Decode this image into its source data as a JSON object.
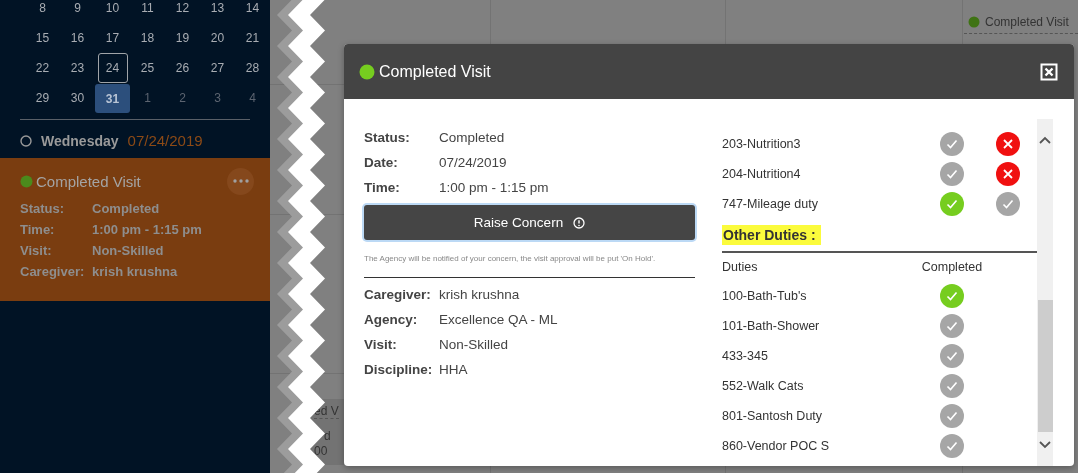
{
  "calendar": {
    "weeks": [
      [
        {
          "day": "8",
          "outside": false,
          "today": false,
          "selected": false
        },
        {
          "day": "9",
          "outside": false,
          "today": false,
          "selected": false
        },
        {
          "day": "10",
          "outside": false,
          "today": false,
          "selected": false
        },
        {
          "day": "11",
          "outside": false,
          "today": false,
          "selected": false
        },
        {
          "day": "12",
          "outside": false,
          "today": false,
          "selected": false
        },
        {
          "day": "13",
          "outside": false,
          "today": false,
          "selected": false
        },
        {
          "day": "14",
          "outside": false,
          "today": false,
          "selected": false
        }
      ],
      [
        {
          "day": "15",
          "outside": false,
          "today": false,
          "selected": false
        },
        {
          "day": "16",
          "outside": false,
          "today": false,
          "selected": false
        },
        {
          "day": "17",
          "outside": false,
          "today": false,
          "selected": false
        },
        {
          "day": "18",
          "outside": false,
          "today": false,
          "selected": false
        },
        {
          "day": "19",
          "outside": false,
          "today": false,
          "selected": false
        },
        {
          "day": "20",
          "outside": false,
          "today": false,
          "selected": false
        },
        {
          "day": "21",
          "outside": false,
          "today": false,
          "selected": false
        }
      ],
      [
        {
          "day": "22",
          "outside": false,
          "today": false,
          "selected": false
        },
        {
          "day": "23",
          "outside": false,
          "today": false,
          "selected": false
        },
        {
          "day": "24",
          "outside": false,
          "today": true,
          "selected": false
        },
        {
          "day": "25",
          "outside": false,
          "today": false,
          "selected": false
        },
        {
          "day": "26",
          "outside": false,
          "today": false,
          "selected": false
        },
        {
          "day": "27",
          "outside": false,
          "today": false,
          "selected": false
        },
        {
          "day": "28",
          "outside": false,
          "today": false,
          "selected": false
        }
      ],
      [
        {
          "day": "29",
          "outside": false,
          "today": false,
          "selected": false
        },
        {
          "day": "30",
          "outside": false,
          "today": false,
          "selected": false
        },
        {
          "day": "31",
          "outside": false,
          "today": false,
          "selected": true
        },
        {
          "day": "1",
          "outside": true,
          "today": false,
          "selected": false
        },
        {
          "day": "2",
          "outside": true,
          "today": false,
          "selected": false
        },
        {
          "day": "3",
          "outside": true,
          "today": false,
          "selected": false
        },
        {
          "day": "4",
          "outside": true,
          "today": false,
          "selected": false
        }
      ]
    ]
  },
  "day_heading": {
    "weekday": "Wednesday",
    "date": "07/24/2019"
  },
  "visit_card": {
    "title": "Completed Visit",
    "fields": [
      {
        "label": "Status:",
        "value": "Completed"
      },
      {
        "label": "Time:",
        "value": "1:00 pm - 1:15 pm"
      },
      {
        "label": "Visit:",
        "value": "Non-Skilled"
      },
      {
        "label": "Caregiver:",
        "value": "krish krushna"
      }
    ]
  },
  "background": {
    "event_title": "Completed Visit",
    "fragments": [
      "ed V",
      "d",
      "00"
    ]
  },
  "modal": {
    "title": "Completed Visit",
    "details": [
      {
        "label": "Status:",
        "value": "Completed"
      },
      {
        "label": "Date:",
        "value": "07/24/2019"
      },
      {
        "label": "Time:",
        "value": "1:00 pm - 1:15 pm"
      }
    ],
    "button": "Raise Concern",
    "note": "The Agency will be notified of your concern, the visit approval will be put 'On Hold'.",
    "people": [
      {
        "label": "Caregiver:",
        "value": "krish krushna"
      },
      {
        "label": "Agency:",
        "value": "Excellence QA - ML"
      },
      {
        "label": "Visit:",
        "value": "Non-Skilled"
      },
      {
        "label": "Discipline:",
        "value": "HHA"
      }
    ],
    "duties": [
      {
        "name": "203-Nutrition3",
        "marks": [
          {
            "kind": "pending"
          },
          {
            "kind": "missed"
          }
        ]
      },
      {
        "name": "204-Nutrition4",
        "marks": [
          {
            "kind": "pending"
          },
          {
            "kind": "missed"
          }
        ]
      },
      {
        "name": "747-Mileage duty",
        "marks": [
          {
            "kind": "done"
          },
          {
            "kind": "pending"
          }
        ]
      }
    ],
    "other_duties": {
      "heading": "Other Duties :",
      "columns": [
        "Duties",
        "Completed"
      ],
      "rows": [
        {
          "name": "100-Bath-Tub's",
          "kind": "done"
        },
        {
          "name": "101-Bath-Shower",
          "kind": "pending"
        },
        {
          "name": "433-345",
          "kind": "pending"
        },
        {
          "name": "552-Walk Cats",
          "kind": "pending"
        },
        {
          "name": "801-Santosh Duty",
          "kind": "pending"
        },
        {
          "name": "860-Vendor POC S",
          "kind": "pending"
        }
      ]
    }
  }
}
